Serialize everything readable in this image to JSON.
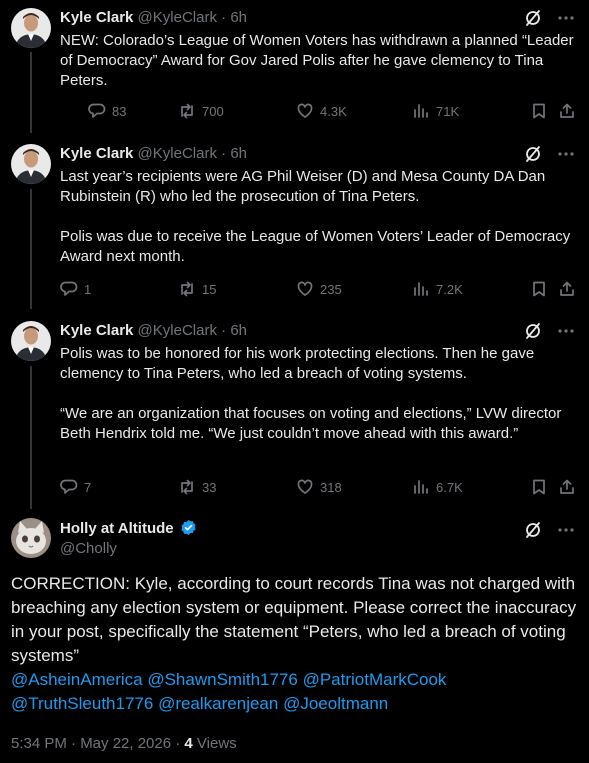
{
  "tweets": [
    {
      "name": "Kyle Clark",
      "handle": "@KyleClark",
      "time": "6h",
      "paragraphs": [
        "NEW: Colorado’s League of Women Voters has withdrawn a planned “Leader of Democracy” Award for Gov Jared Polis after he gave clemency to Tina Peters."
      ],
      "replies": "83",
      "reposts": "700",
      "likes": "4.3K",
      "views": "71K"
    },
    {
      "name": "Kyle Clark",
      "handle": "@KyleClark",
      "time": "6h",
      "paragraphs": [
        "Last year’s recipients were AG Phil Weiser (D) and Mesa County DA Dan Rubinstein (R) who led the prosecution of Tina Peters.",
        "Polis was due to receive the League of Women Voters’ Leader of Democracy Award next month."
      ],
      "replies": "1",
      "reposts": "15",
      "likes": "235",
      "views": "7.2K"
    },
    {
      "name": "Kyle Clark",
      "handle": "@KyleClark",
      "time": "6h",
      "paragraphs": [
        "Polis was to be honored for his work protecting elections. Then he gave clemency to Tina Peters, who led a breach of voting systems.",
        "“We are an organization that focuses on voting and elections,” LVW director Beth Hendrix told me. “We just couldn’t move ahead with this award.”"
      ],
      "replies": "7",
      "reposts": "33",
      "likes": "318",
      "views": "6.7K"
    }
  ],
  "main": {
    "name": "Holly at Altitude",
    "handle": "@Cholly",
    "text": "CORRECTION:  Kyle, according to court records Tina was not charged with breaching any election system or equipment.   Please correct the inaccuracy in your post, specifically the statement “Peters,  who led a breach of voting systems”",
    "mentions": [
      "@AsheinAmerica",
      "@ShawnSmith1776",
      "@PatriotMarkCook",
      "@TruthSleuth1776",
      "@realkarenjean",
      "@Joeoltmann"
    ],
    "timestamp": "5:34 PM · May 22, 2026 · ",
    "views_count": "4",
    "views_label": " Views"
  },
  "icons": {
    "grok": "grok-icon",
    "more": "more-icon",
    "reply": "reply-icon",
    "repost": "repost-icon",
    "like": "like-icon",
    "views": "views-icon",
    "bookmark": "bookmark-icon",
    "share": "share-icon",
    "verified": "verified-badge-icon"
  },
  "colors": {
    "background": "#000000",
    "text": "#e7e9ea",
    "muted": "#71767b",
    "link": "#1d9bf0"
  }
}
